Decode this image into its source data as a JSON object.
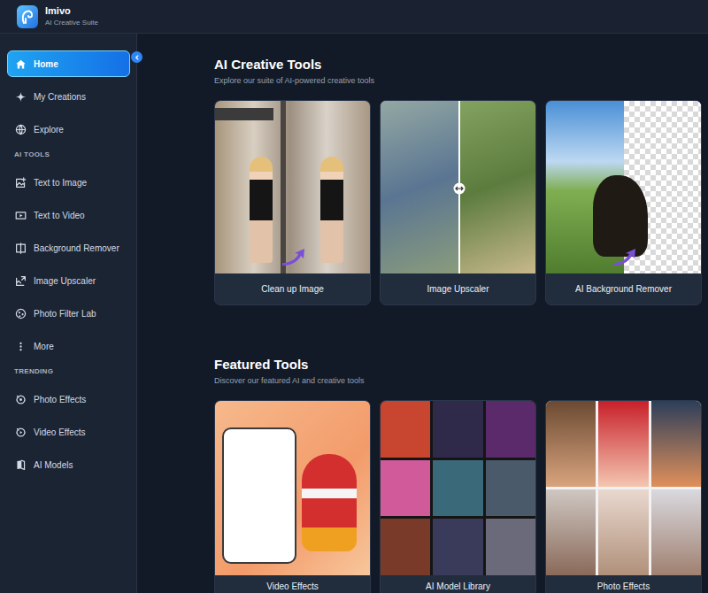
{
  "app": {
    "title": "Imivo",
    "subtitle": "AI Creative Suite"
  },
  "sidebar": {
    "items": [
      {
        "label": "Home",
        "selected": true
      },
      {
        "label": "My Creations",
        "selected": false
      },
      {
        "label": "Explore",
        "selected": false
      }
    ],
    "sections": [
      {
        "heading": "AI TOOLS",
        "items": [
          {
            "label": "Text to Image",
            "selected": false
          },
          {
            "label": "Text to Video",
            "selected": false
          },
          {
            "label": "Background Remover",
            "selected": false
          },
          {
            "label": "Image Upscaler",
            "selected": false
          },
          {
            "label": "Photo Filter Lab",
            "selected": false
          },
          {
            "label": "More",
            "selected": false
          }
        ]
      },
      {
        "heading": "TRENDING",
        "items": [
          {
            "label": "Photo Effects",
            "selected": false
          },
          {
            "label": "Video Effects",
            "selected": false
          },
          {
            "label": "AI Models",
            "selected": false
          }
        ]
      }
    ]
  },
  "sections": [
    {
      "title": "AI Creative Tools",
      "subtitle": "Explore our suite of AI-powered creative tools",
      "cards": [
        {
          "label": "Clean up Image"
        },
        {
          "label": "Image Upscaler"
        },
        {
          "label": "AI Background Remover"
        }
      ]
    },
    {
      "title": "Featured Tools",
      "subtitle": "Discover our featured AI and creative tools",
      "cards": [
        {
          "label": "Video Effects"
        },
        {
          "label": "AI Model Library"
        },
        {
          "label": "Photo Effects"
        }
      ]
    }
  ]
}
